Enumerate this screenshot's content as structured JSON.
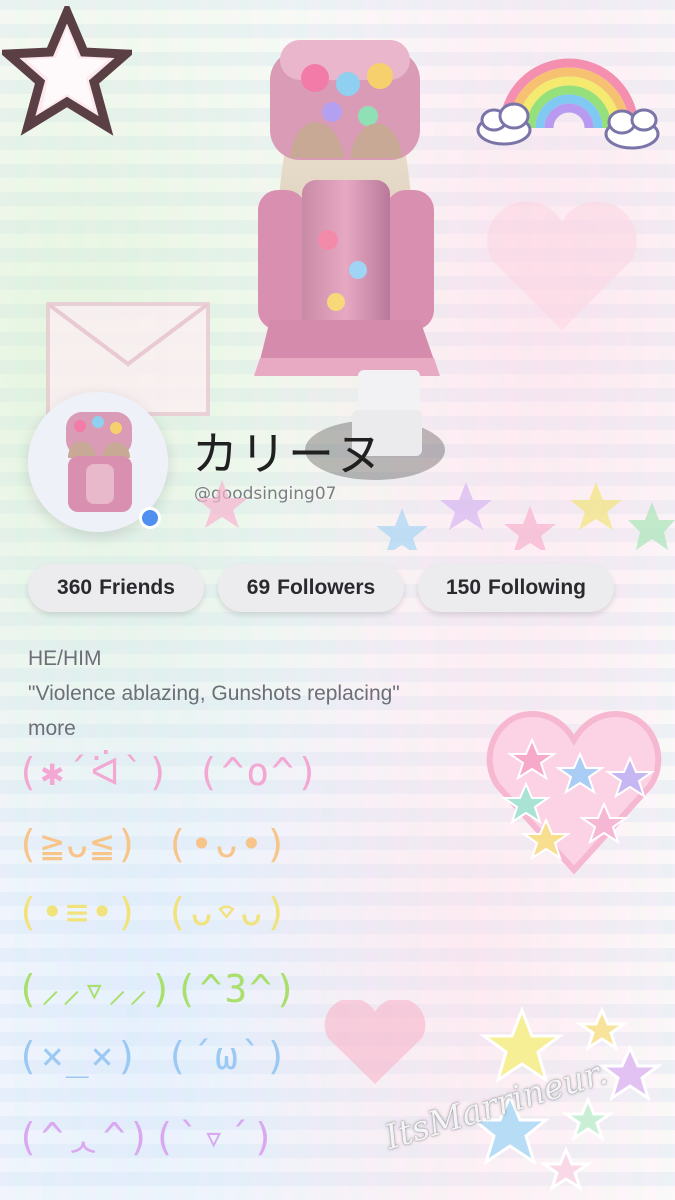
{
  "profile": {
    "display_name": "カリーヌ",
    "username": "@goodsinging07",
    "online_status_color": "#4f8ff0"
  },
  "stats": [
    {
      "value": "360",
      "label": "Friends"
    },
    {
      "value": "69",
      "label": "Followers"
    },
    {
      "value": "150",
      "label": "Following"
    }
  ],
  "bio": {
    "line1": "HE/HIM",
    "line2": "\"Violence ablazing, Gunshots replacing\"",
    "more_label": "more"
  },
  "kaomoji": {
    "row1": "(✱´ᐛ`) (^o^)",
    "row2": "(≧ᴗ≦) (•ᴗ•)",
    "row3": "(•≡•) (ᴗ⌔ᴗ)",
    "row4": "(⸝⸝▿⸝⸝)(^3^)",
    "row5": "(×_×) (´ω`)",
    "row6": "(^ᆺ^)(`▿´)"
  },
  "watermark": "ItsMarrineur.",
  "colors": {
    "kaomoji_pink": "#f2a8d2",
    "kaomoji_orange": "#f7c58a",
    "kaomoji_yellow": "#f1e27c",
    "kaomoji_green": "#a9df6c",
    "kaomoji_blue": "#9cc9f3"
  }
}
